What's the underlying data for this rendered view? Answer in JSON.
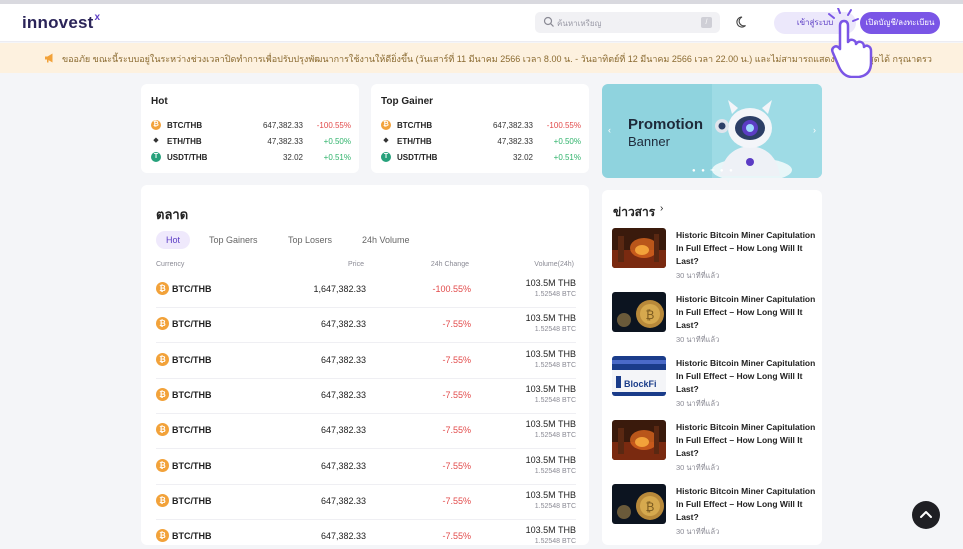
{
  "header": {
    "logo_text": "innovest",
    "logo_superscript": "x",
    "search_placeholder": "ค้นหาเหรียญ",
    "search_kbd": "/",
    "login_label": "เข้าสู่ระบบ",
    "register_label": "เปิดบัญชี/ลงทะเบียน"
  },
  "announcement": {
    "text": "ขออภัย ขณะนี้ระบบอยู่ในระหว่างช่วงเวลาปิดทำการเพื่อปรับปรุงพัฒนาการใช้งานให้ดียิ่งขึ้น (วันเสาร์ที่ 11 มีนาคม 2566 เวลา 8.00 น. - วันอาทิตย์ที่ 12 มีนาคม 2566 เวลา 22.00 น.) และไม่สามารถแสดงข้อมูลล่าสุดได้ กรุณาตรวจสอบอีกครั้งหลังจาก..."
  },
  "hot_card": {
    "title": "Hot",
    "rows": [
      {
        "icon": "bitcoin-icon",
        "pair": "BTC/THB",
        "price": "647,382.33",
        "change": "-100.55%",
        "dir": "neg"
      },
      {
        "icon": "ethereum-icon",
        "pair": "ETH/THB",
        "price": "47,382.33",
        "change": "+0.50%",
        "dir": "pos"
      },
      {
        "icon": "tether-icon",
        "pair": "USDT/THB",
        "price": "32.02",
        "change": "+0.51%",
        "dir": "pos"
      }
    ]
  },
  "gainer_card": {
    "title": "Top Gainer",
    "rows": [
      {
        "icon": "bitcoin-icon",
        "pair": "BTC/THB",
        "price": "647,382.33",
        "change": "-100.55%",
        "dir": "neg"
      },
      {
        "icon": "ethereum-icon",
        "pair": "ETH/THB",
        "price": "47,382.33",
        "change": "+0.50%",
        "dir": "pos"
      },
      {
        "icon": "tether-icon",
        "pair": "USDT/THB",
        "price": "32.02",
        "change": "+0.51%",
        "dir": "pos"
      }
    ]
  },
  "promo": {
    "line1": "Promotion",
    "line2": "Banner",
    "prev": "‹",
    "next": "›"
  },
  "market": {
    "title": "ตลาด",
    "tabs": [
      "Hot",
      "Top Gainers",
      "Top Losers",
      "24h Volume"
    ],
    "active_tab": 0,
    "columns": {
      "currency": "Currency",
      "price": "Price",
      "change": "24h Change",
      "volume": "Volume(24h)"
    },
    "rows": [
      {
        "pair": "BTC/THB",
        "price": "1,647,382.33",
        "change": "-100.55%",
        "volume": "103.5M THB",
        "volume_btc": "1.52548 BTC"
      },
      {
        "pair": "BTC/THB",
        "price": "647,382.33",
        "change": "-7.55%",
        "volume": "103.5M THB",
        "volume_btc": "1.52548 BTC"
      },
      {
        "pair": "BTC/THB",
        "price": "647,382.33",
        "change": "-7.55%",
        "volume": "103.5M THB",
        "volume_btc": "1.52548 BTC"
      },
      {
        "pair": "BTC/THB",
        "price": "647,382.33",
        "change": "-7.55%",
        "volume": "103.5M THB",
        "volume_btc": "1.52548 BTC"
      },
      {
        "pair": "BTC/THB",
        "price": "647,382.33",
        "change": "-7.55%",
        "volume": "103.5M THB",
        "volume_btc": "1.52548 BTC"
      },
      {
        "pair": "BTC/THB",
        "price": "647,382.33",
        "change": "-7.55%",
        "volume": "103.5M THB",
        "volume_btc": "1.52548 BTC"
      },
      {
        "pair": "BTC/THB",
        "price": "647,382.33",
        "change": "-7.55%",
        "volume": "103.5M THB",
        "volume_btc": "1.52548 BTC"
      },
      {
        "pair": "BTC/THB",
        "price": "647,382.33",
        "change": "-7.55%",
        "volume": "103.5M THB",
        "volume_btc": "1.52548 BTC"
      }
    ]
  },
  "news": {
    "title": "ข่าวสาร",
    "chevron": "›",
    "items": [
      {
        "headline": "Historic Bitcoin Miner Capitulation In Full Effect – How Long Will It Last?",
        "time": "30 นาทีที่แล้ว",
        "thumb": "fire"
      },
      {
        "headline": "Historic Bitcoin Miner Capitulation In Full Effect – How Long Will It Last?",
        "time": "30 นาทีที่แล้ว",
        "thumb": "coin"
      },
      {
        "headline": "Historic Bitcoin Miner Capitulation In Full Effect – How Long Will It Last?",
        "time": "30 นาทีที่แล้ว",
        "thumb": "blockfi"
      },
      {
        "headline": "Historic Bitcoin Miner Capitulation In Full Effect – How Long Will It Last?",
        "time": "30 นาทีที่แล้ว",
        "thumb": "fire"
      },
      {
        "headline": "Historic Bitcoin Miner Capitulation In Full Effect – How Long Will It Last?",
        "time": "30 นาทีที่แล้ว",
        "thumb": "coin"
      }
    ],
    "blockfi_label": "BlockFi"
  },
  "colors": {
    "brand": "#5b3cc4",
    "accent": "#7a55e6",
    "negative": "#e24a4a",
    "positive": "#2fb36b",
    "announcement_bg": "#fdf1df"
  }
}
